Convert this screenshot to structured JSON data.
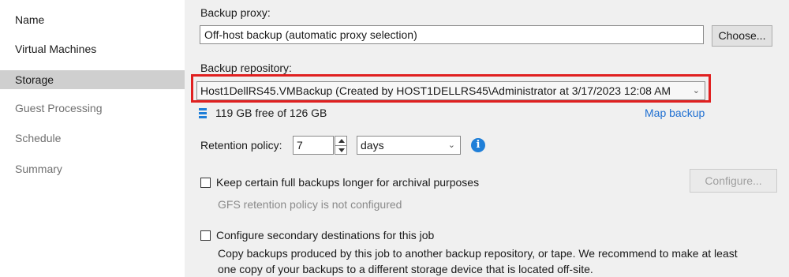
{
  "sidebar": {
    "items": [
      {
        "label": "Name",
        "state": "normal"
      },
      {
        "label": "Virtual Machines",
        "state": "normal"
      },
      {
        "label": "Storage",
        "state": "selected"
      },
      {
        "label": "Guest Processing",
        "state": "disabled"
      },
      {
        "label": "Schedule",
        "state": "disabled"
      },
      {
        "label": "Summary",
        "state": "disabled"
      }
    ]
  },
  "proxy": {
    "label": "Backup proxy:",
    "value": "Off-host backup (automatic proxy selection)",
    "choose_label": "Choose..."
  },
  "repository": {
    "label": "Backup repository:",
    "value": "Host1DellRS45.VMBackup (Created by HOST1DELLRS45\\Administrator at 3/17/2023 12:08 AM",
    "free_space": "119 GB free of 126 GB",
    "map_label": "Map backup",
    "highlight_color": "#e02020"
  },
  "retention": {
    "label": "Retention policy:",
    "value": "7",
    "unit": "days"
  },
  "gfs": {
    "checkbox_label": "Keep certain full backups longer for archival purposes",
    "checked": false,
    "status": "GFS retention policy is not configured",
    "configure_label": "Configure..."
  },
  "secondary": {
    "checkbox_label": "Configure secondary destinations for this job",
    "checked": false,
    "description_line1": "Copy backups produced by this job to another backup repository, or tape. We recommend to make at least",
    "description_line2": "one copy of your backups to a different storage device that is located off-site."
  },
  "colors": {
    "accent": "#1f6fd1",
    "info": "#1f7fd8",
    "selected_bg": "#cfcfcf"
  },
  "icons": {
    "database": "database-icon",
    "info": "info-icon",
    "spinner": "spinner-icon",
    "dropdown": "chevron-down-icon"
  }
}
